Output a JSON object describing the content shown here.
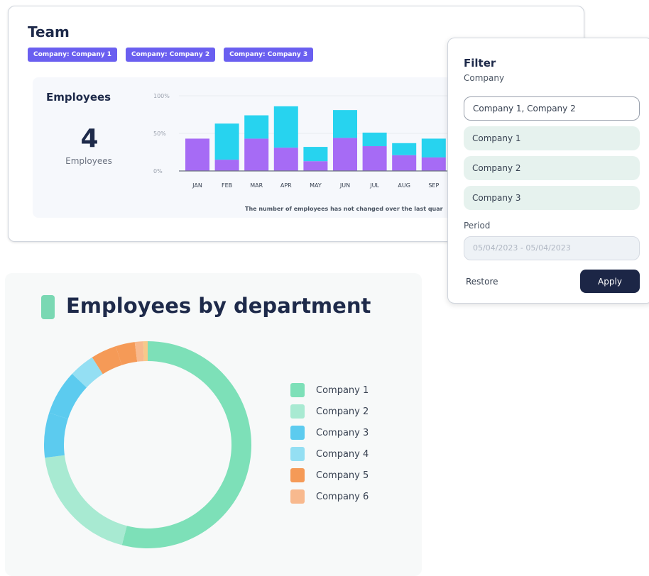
{
  "team": {
    "title": "Team",
    "tags": [
      "Company: Company 1",
      "Company: Company 2",
      "Company: Company 3"
    ],
    "employees_title": "Employees",
    "employees_count": "4",
    "employees_count_label": "Employees",
    "chart_note": "The number of employees has not changed over the last quar"
  },
  "filter": {
    "title": "Filter",
    "company_label": "Company",
    "company_value": "Company 1, Company 2",
    "options": [
      "Company 1",
      "Company 2",
      "Company 3"
    ],
    "period_label": "Period",
    "period_placeholder": "05/04/2023 - 05/04/2023",
    "restore_label": "Restore",
    "apply_label": "Apply"
  },
  "department": {
    "title": "Employees by department"
  },
  "colors": {
    "tag_bg": "#6a5ff0",
    "bar_purple": "#a66bf5",
    "bar_cyan": "#27d3ef",
    "bar_cyan_light": "#5dd2f2",
    "apply_bg": "#1c2646"
  },
  "chart_data": [
    {
      "type": "bar",
      "stacked": true,
      "categories": [
        "JAN",
        "FEB",
        "MAR",
        "APR",
        "MAY",
        "JUN",
        "JUL",
        "AUG",
        "SEP"
      ],
      "y_tick_labels": [
        "100%",
        "50%",
        "0%"
      ],
      "ylim": [
        0,
        100
      ],
      "series": [
        {
          "color": "#a66bf5",
          "values": [
            43,
            15,
            43,
            31,
            13,
            44,
            33,
            21,
            18
          ]
        },
        {
          "color": "#27d3ef",
          "values": [
            0,
            48,
            31,
            55,
            19,
            37,
            18,
            16,
            25
          ]
        }
      ],
      "grid": true
    },
    {
      "type": "pie",
      "donut": true,
      "legend": [
        "Company 1",
        "Company 2",
        "Company 3",
        "Company 4",
        "Company 5",
        "Company 6"
      ],
      "legend_colors": [
        "#7de0b8",
        "#a8ead2",
        "#5ccbef",
        "#94dff3",
        "#f59a57",
        "#f8b98e"
      ],
      "slices": [
        {
          "color": "#7de0b8",
          "value": 54
        },
        {
          "color": "#a8ead2",
          "value": 19
        },
        {
          "color": "#5ccbef",
          "value": 7
        },
        {
          "color": "#5ccbef",
          "value": 7
        },
        {
          "color": "#94dff3",
          "value": 4
        },
        {
          "color": "#f59a57",
          "value": 4
        },
        {
          "color": "#f59a57",
          "value": 3
        },
        {
          "color": "#f8b98e",
          "value": 1.3
        },
        {
          "color": "#f7c98a",
          "value": 0.7
        }
      ]
    }
  ]
}
